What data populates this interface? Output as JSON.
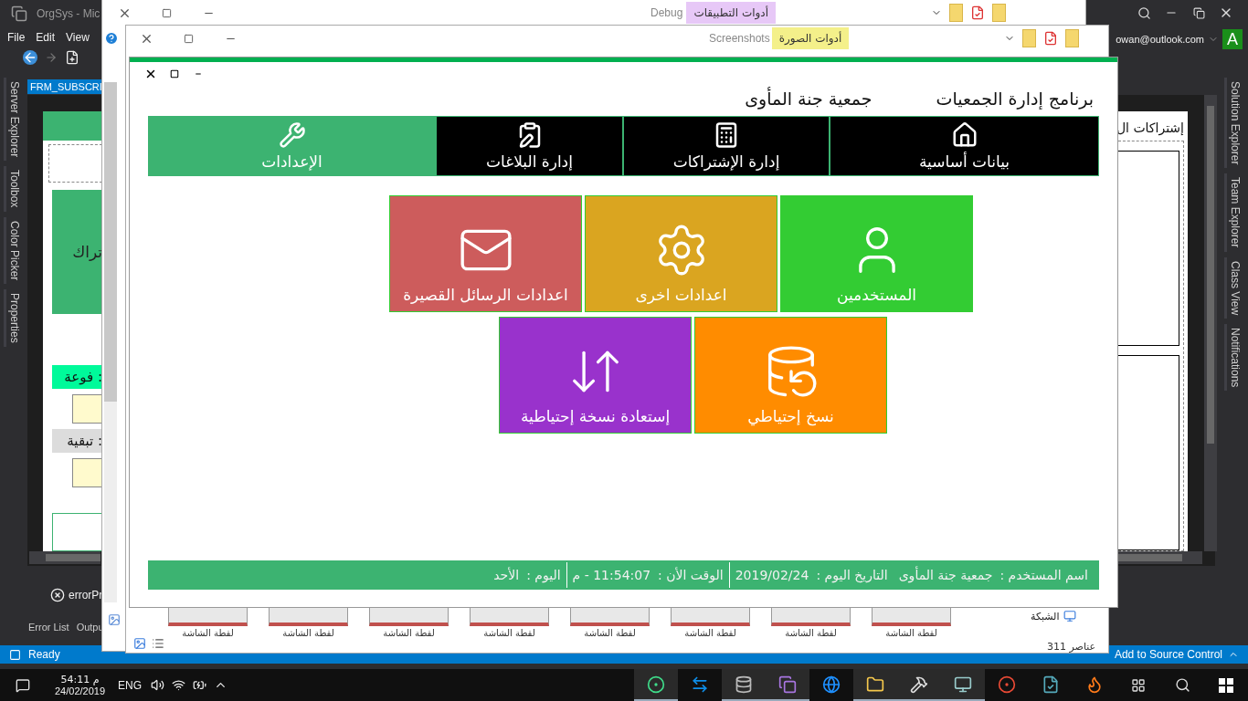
{
  "vs": {
    "title": "OrgSys - Mic",
    "menu": {
      "file": "File",
      "edit": "Edit",
      "view": "View"
    },
    "account": "owan@outlook.com",
    "avatar": "A",
    "document_tab": "FRM_SUBSCRI",
    "left_tabs": [
      "Server Explorer",
      "Toolbox",
      "Color Picker",
      "Properties"
    ],
    "right_tabs": [
      "Solution Explorer",
      "Team Explorer",
      "Class View",
      "Notifications"
    ],
    "designer_left": {
      "header_text": "تراك",
      "labels": [
        "فوعة :",
        "تبقية :"
      ]
    },
    "designer_right": {
      "title": "إشتراكات ال"
    },
    "error_item": "errorPr",
    "bottom_tabs": {
      "error_list": "Error List",
      "output": "Outpu"
    },
    "status": "Ready",
    "source_control": "Add to Source Control"
  },
  "explorer_back": {
    "ribbon_label": "Debug",
    "context_tab": "أدوات التطبيقات"
  },
  "explorer_front": {
    "ribbon_label": "Screenshots",
    "context_tab": "أدوات الصورة",
    "thumbnails": [
      "لقطة الشاشة",
      "لقطة الشاشة",
      "لقطة الشاشة",
      "لقطة الشاشة",
      "لقطة الشاشة",
      "لقطة الشاشة",
      "لقطة الشاشة",
      "لقطة الشاشة"
    ],
    "nav_item": "الشبكة",
    "item_count": "311 عناصر"
  },
  "app": {
    "program_title": "برنامج إدارة الجمعيات",
    "org_name": "جمعية جنة المأوى",
    "nav": [
      {
        "label": "بيانات أساسية",
        "selected": false
      },
      {
        "label": "إدارة الإشتراكات",
        "selected": false
      },
      {
        "label": "إدارة البلاغات",
        "selected": false
      },
      {
        "label": "الإعدادات",
        "selected": true
      }
    ],
    "tile_rows": [
      [
        {
          "label": "المستخدمين",
          "color": "#33cc33"
        },
        {
          "label": "اعدادات اخرى",
          "color": "#daa520"
        },
        {
          "label": "اعدادات الرسائل القصيرة",
          "color": "#cd5c5c"
        }
      ],
      [
        {
          "label": "نسخ إحتياطي",
          "color": "#ff8c00"
        },
        {
          "label": "إستعادة نسخة إحتياطية",
          "color": "#9932cc"
        }
      ]
    ],
    "status": [
      {
        "label": "اسم المستخدم :",
        "value": "جمعية جنة المأوى"
      },
      {
        "label": "التاريخ اليوم :",
        "value": "2019/02/24"
      },
      {
        "label": "الوقت الأن :",
        "value": "11:54:07 - م"
      },
      {
        "label": "اليوم :",
        "value": "الأحد"
      }
    ]
  },
  "taskbar": {
    "time": "54:11 م",
    "date": "24/02/2019",
    "language": "ENG",
    "apps": [
      {
        "running": true
      },
      {
        "running": false
      },
      {
        "running": true
      },
      {
        "running": true
      },
      {
        "running": false
      },
      {
        "running": true
      },
      {
        "running": true
      },
      {
        "running": true
      },
      {
        "running": false
      },
      {
        "running": false
      },
      {
        "running": false
      }
    ]
  }
}
